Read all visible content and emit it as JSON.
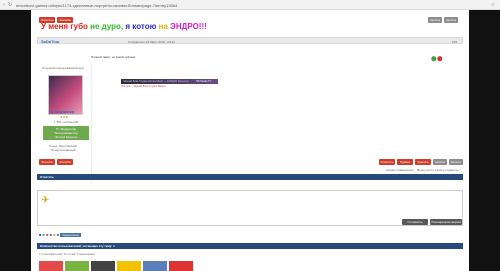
{
  "browser": {
    "url": "nmonikovi-games.ru/topic/1174-сделанные-портреты-своими-ботами/page-7#entry13064"
  },
  "header": {
    "title_parts": [
      "У меня губо",
      "не дуро,",
      "я котою",
      "на",
      "ЭНДРО!!!"
    ],
    "colors": [
      "#e02020",
      "#2dbf2d",
      "#2b2bd0",
      "#e0b000",
      "#d020d0"
    ]
  },
  "topbuttons": {
    "reply": "Ответить",
    "complaint": "Жалоба",
    "quote": "Цитата",
    "multi": "Цитата"
  },
  "post": {
    "author": "SaDaTina",
    "date": "Отправлено 23 Март 2016 - 20:34",
    "number": "#16",
    "subtitle": "Полный пакет, но какой суфием",
    "embed_title": "Чёрный Блик Студия (Unrecorded) — All Rights Reserved",
    "embed_badge": "HD Studio TV",
    "embed_desc": "Эта для... Чёрный Блик Студия Видео",
    "user": {
      "rank_line": "Старшей подозреваемый друг",
      "name": "Гл. Модератор",
      "stars": "★★★",
      "posts": "1 551 сообщений",
      "green_line1": "Гл. Модератор",
      "green_line2": "Тестеровщик игр",
      "green_line3": "Чистый ванилин",
      "city": "Город: Ярославский",
      "city2": "Предполагающий"
    },
    "buttons": {
      "report": "Жалоба",
      "reply": "Ответить",
      "edit": "Правка",
      "delete": "Удалить",
      "quote": "Цитата",
      "multiquote": "Мульти"
    }
  },
  "pager": {
    "text": "Скорее правильные: · Вернуться к началу страницы ↑"
  },
  "reply_section": {
    "header": "Ответить",
    "send": "Отправить",
    "advanced": "Расширенная форма"
  },
  "share_label": "Поделиться",
  "readers": {
    "header": "Количество пользователей, читающих эту тему: 1",
    "detail": "1 пользователей, 0 гостей, 0 анонимных"
  }
}
